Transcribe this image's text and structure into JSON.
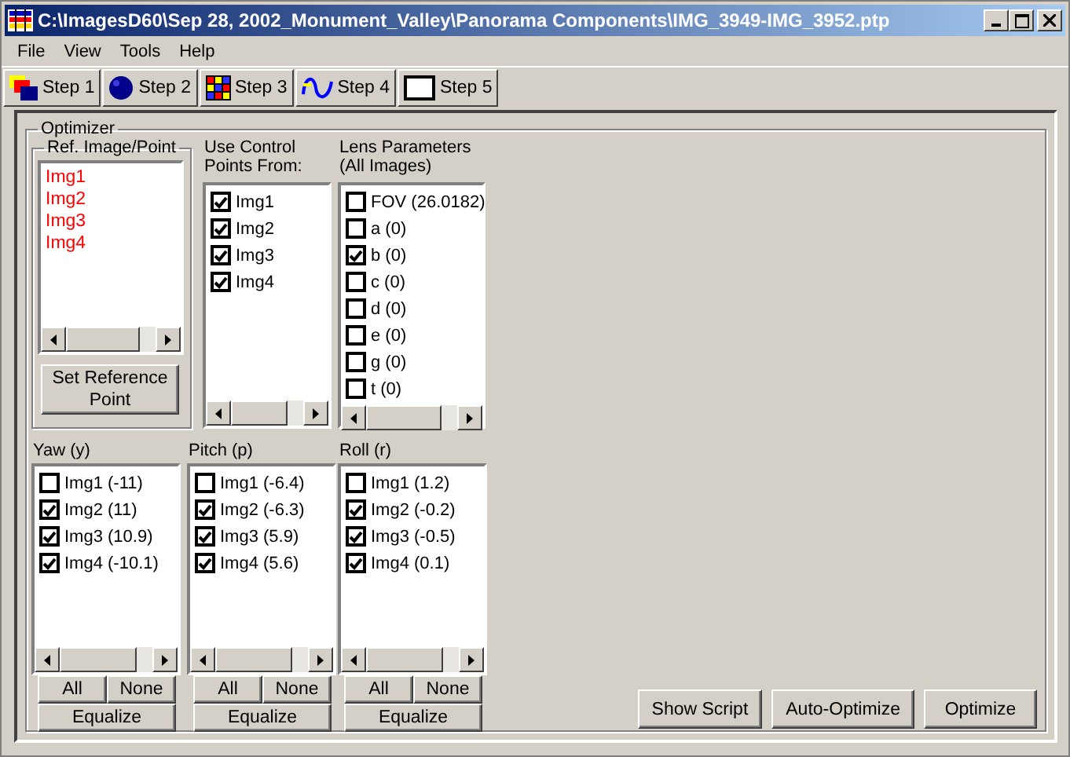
{
  "window": {
    "title": "C:\\ImagesD60\\Sep 28, 2002_Monument_Valley\\Panorama Components\\IMG_3949-IMG_3952.ptp"
  },
  "menu": [
    "File",
    "View",
    "Tools",
    "Help"
  ],
  "toolbar": [
    {
      "label": "Step 1",
      "kind": "overlap"
    },
    {
      "label": "Step 2",
      "kind": "sphere"
    },
    {
      "label": "Step 3",
      "kind": "grid"
    },
    {
      "label": "Step 4",
      "kind": "wave"
    },
    {
      "label": "Step 5",
      "kind": "frame"
    }
  ],
  "optimizer": {
    "title": "Optimizer",
    "reference": {
      "title": "Ref. Image/Point",
      "items": [
        "Img1",
        "Img2",
        "Img3",
        "Img4"
      ],
      "button": "Set Reference Point"
    },
    "control_points": {
      "title": "Use Control Points From:",
      "items": [
        {
          "label": "Img1",
          "checked": true
        },
        {
          "label": "Img2",
          "checked": true
        },
        {
          "label": "Img3",
          "checked": true
        },
        {
          "label": "Img4",
          "checked": true
        }
      ]
    },
    "lens_parameters": {
      "title": "Lens Parameters (All Images)",
      "items": [
        {
          "label": "FOV (26.0182)",
          "checked": false
        },
        {
          "label": "a (0)",
          "checked": false
        },
        {
          "label": "b (0)",
          "checked": true
        },
        {
          "label": "c (0)",
          "checked": false
        },
        {
          "label": "d (0)",
          "checked": false
        },
        {
          "label": "e (0)",
          "checked": false
        },
        {
          "label": "g (0)",
          "checked": false
        },
        {
          "label": "t (0)",
          "checked": false
        }
      ]
    },
    "angles": [
      {
        "title": "Yaw (y)",
        "items": [
          {
            "label": "Img1 (-11)",
            "checked": false
          },
          {
            "label": "Img2 (11)",
            "checked": true
          },
          {
            "label": "Img3 (10.9)",
            "checked": true
          },
          {
            "label": "Img4 (-10.1)",
            "checked": true
          }
        ],
        "buttons": [
          "All",
          "None"
        ],
        "equalize": "Equalize"
      },
      {
        "title": "Pitch (p)",
        "items": [
          {
            "label": "Img1 (-6.4)",
            "checked": false
          },
          {
            "label": "Img2 (-6.3)",
            "checked": true
          },
          {
            "label": "Img3 (5.9)",
            "checked": true
          },
          {
            "label": "Img4 (5.6)",
            "checked": true
          }
        ],
        "buttons": [
          "All",
          "None"
        ],
        "equalize": "Equalize"
      },
      {
        "title": "Roll (r)",
        "items": [
          {
            "label": "Img1 (1.2)",
            "checked": false
          },
          {
            "label": "Img2 (-0.2)",
            "checked": true
          },
          {
            "label": "Img3 (-0.5)",
            "checked": true
          },
          {
            "label": "Img4 (0.1)",
            "checked": true
          }
        ],
        "buttons": [
          "All",
          "None"
        ],
        "equalize": "Equalize"
      }
    ],
    "actions": [
      "Show Script",
      "Auto-Optimize",
      "Optimize"
    ]
  }
}
